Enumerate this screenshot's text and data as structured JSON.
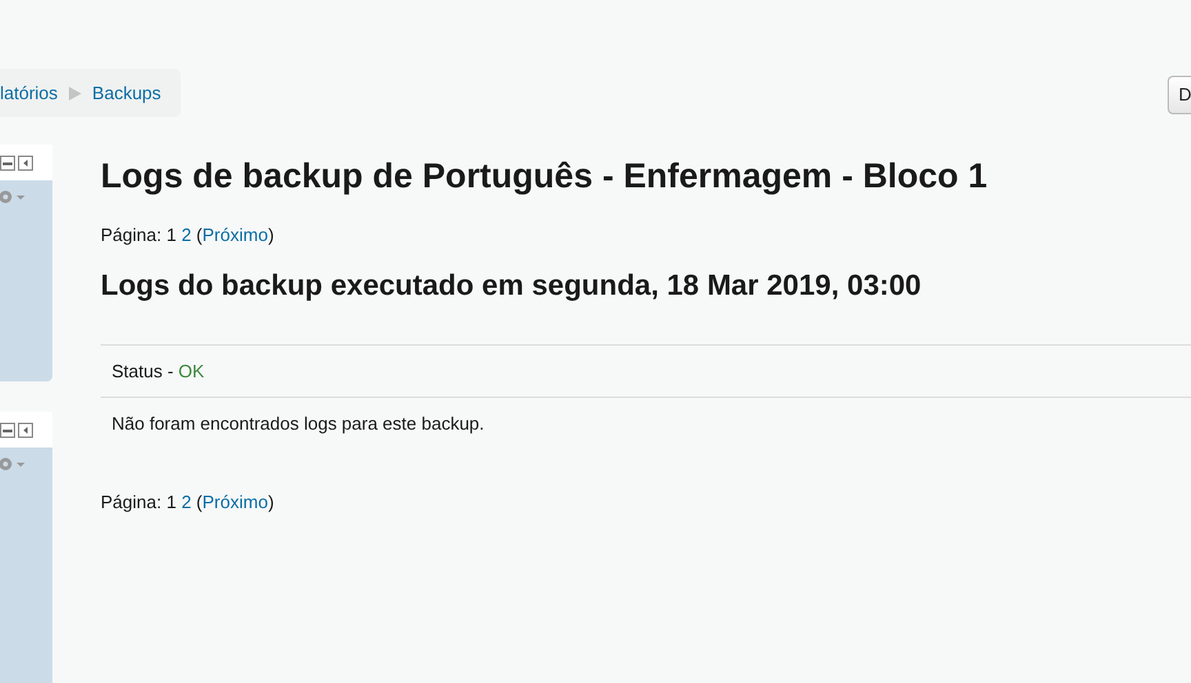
{
  "breadcrumb": [
    {
      "label": "latórios"
    },
    {
      "label": "Backups"
    }
  ],
  "header_button": {
    "label": "D"
  },
  "blocks": [
    {
      "kind": "block"
    },
    {
      "kind": "block"
    }
  ],
  "title": "Logs de backup de Português - Enfermagem - Bloco 1",
  "paging_top": {
    "label": "Página:",
    "pages": [
      {
        "label": "1",
        "selected": true
      },
      {
        "label": "2",
        "selected": false
      }
    ],
    "next_before": "(",
    "next": "Próximo",
    "next_after": ")"
  },
  "subtitle": "Logs do backup executado em segunda, 18 Mar 2019, 03:00",
  "status": {
    "label": "Status - ",
    "value": "OK"
  },
  "message": "Não foram encontrados logs para este backup.",
  "paging_bottom": {
    "label": "Página:",
    "pages": [
      {
        "label": "1",
        "selected": true
      },
      {
        "label": "2",
        "selected": false
      }
    ],
    "next_before": "(",
    "next": "Próximo",
    "next_after": ")"
  }
}
